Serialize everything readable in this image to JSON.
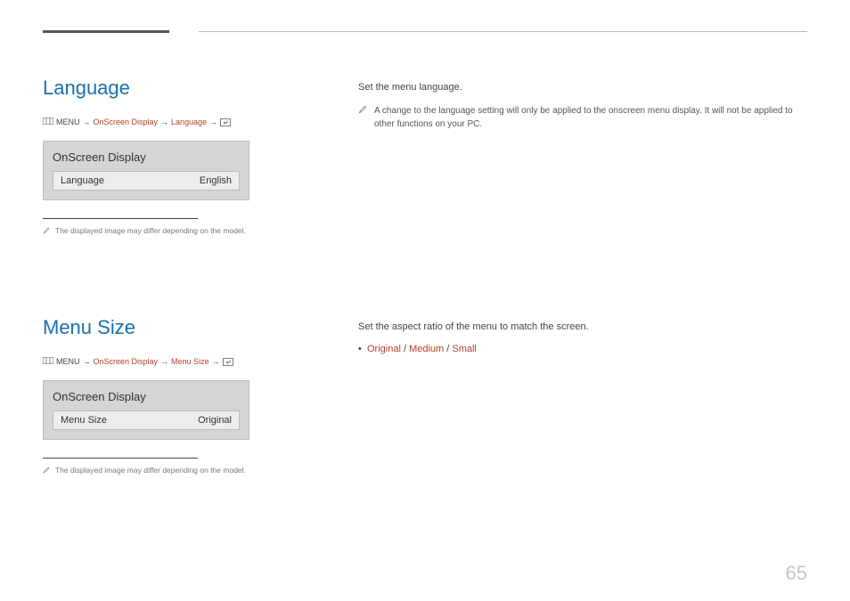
{
  "page_number": "65",
  "sections": [
    {
      "title": "Language",
      "breadcrumb": {
        "menu_label": "MENU",
        "path1": "OnScreen Display",
        "path2": "Language"
      },
      "panel": {
        "title": "OnScreen Display",
        "row_label": "Language",
        "row_value": "English"
      },
      "differ_note": "The displayed image may differ depending on the model.",
      "right_intro": "Set the menu language.",
      "right_note": "A change to the language setting will only be applied to the onscreen menu display. It will not be applied to other functions on your PC."
    },
    {
      "title": "Menu Size",
      "breadcrumb": {
        "menu_label": "MENU",
        "path1": "OnScreen Display",
        "path2": "Menu Size"
      },
      "panel": {
        "title": "OnScreen Display",
        "row_label": "Menu Size",
        "row_value": "Original"
      },
      "differ_note": "The displayed image may differ depending on the model.",
      "right_intro": "Set the aspect ratio of the menu to match the screen.",
      "options": [
        "Original",
        "Medium",
        "Small"
      ],
      "option_sep": " / "
    }
  ]
}
